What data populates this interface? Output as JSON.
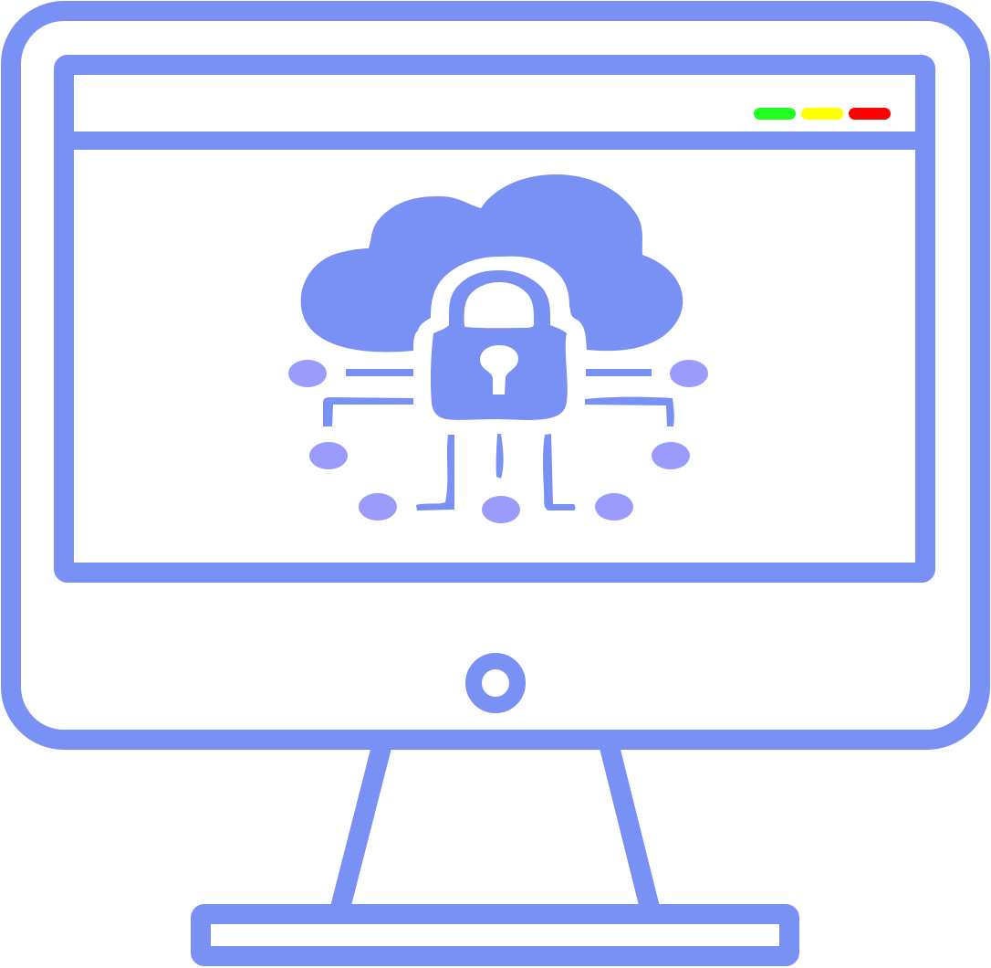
{
  "illustration": {
    "subject": "cloud-security-monitor-icon",
    "colors": {
      "outline": "#7990f4",
      "node": "#9b9bfc",
      "background": "#ffffff",
      "window_light_green": "#21ff21",
      "window_light_yellow": "#ffff00",
      "window_light_red": "#ff0000"
    },
    "icons": {
      "monitor": "monitor-icon",
      "cloud": "cloud-icon",
      "lock": "padlock-icon",
      "network": "network-nodes-icon",
      "power": "power-button-icon"
    }
  }
}
